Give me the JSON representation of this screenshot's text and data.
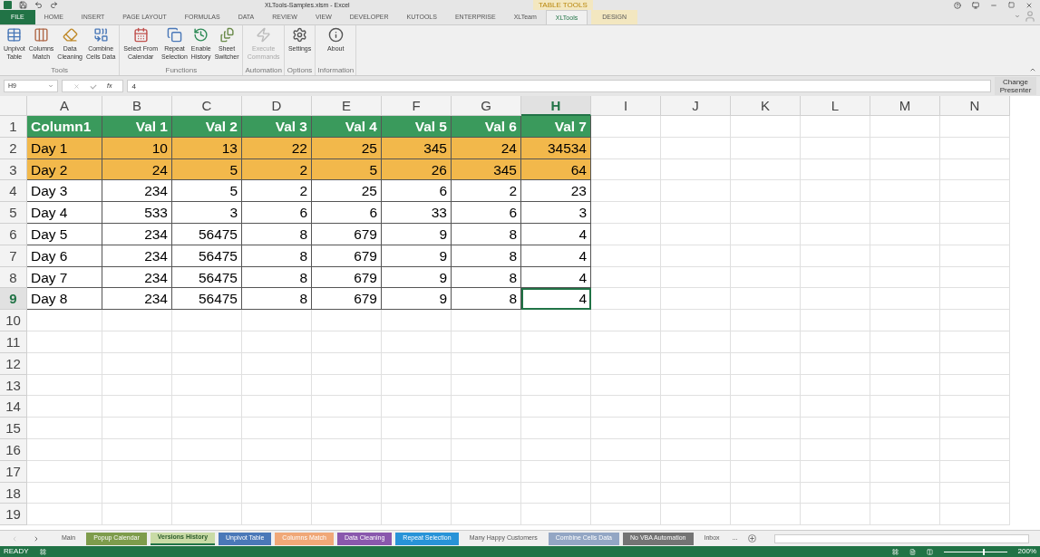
{
  "window": {
    "title": "XLTools-Samples.xlsm - Excel",
    "context_label": "TABLE TOOLS"
  },
  "ribbon_tabs": [
    {
      "label": "FILE",
      "kind": "file",
      "selected": false
    },
    {
      "label": "HOME",
      "kind": "tab",
      "selected": false
    },
    {
      "label": "INSERT",
      "kind": "tab",
      "selected": false
    },
    {
      "label": "PAGE LAYOUT",
      "kind": "tab",
      "selected": false
    },
    {
      "label": "FORMULAS",
      "kind": "tab",
      "selected": false
    },
    {
      "label": "DATA",
      "kind": "tab",
      "selected": false
    },
    {
      "label": "REVIEW",
      "kind": "tab",
      "selected": false
    },
    {
      "label": "VIEW",
      "kind": "tab",
      "selected": false
    },
    {
      "label": "DEVELOPER",
      "kind": "tab",
      "selected": false
    },
    {
      "label": "KUTOOLS",
      "kind": "tab",
      "selected": false
    },
    {
      "label": "ENTERPRISE",
      "kind": "tab",
      "selected": false
    },
    {
      "label": "XLTeam",
      "kind": "tab",
      "selected": false
    },
    {
      "label": "XLTools",
      "kind": "tab",
      "selected": true
    },
    {
      "label": "DESIGN",
      "kind": "context",
      "selected": false
    }
  ],
  "ribbon_groups": [
    {
      "label": "Tools",
      "buttons": [
        {
          "label": "Unpivot\nTable",
          "disabled": false
        },
        {
          "label": "Columns\nMatch",
          "disabled": false
        },
        {
          "label": "Data\nCleaning",
          "disabled": false
        },
        {
          "label": "Combine\nCells Data",
          "disabled": false
        }
      ]
    },
    {
      "label": "Functions",
      "buttons": [
        {
          "label": "Select From\nCalendar",
          "disabled": false
        },
        {
          "label": "Repeat\nSelection",
          "disabled": false
        },
        {
          "label": "Enable\nHistory",
          "disabled": false
        },
        {
          "label": "Sheet\nSwitcher",
          "disabled": false
        }
      ]
    },
    {
      "label": "Automation",
      "buttons": [
        {
          "label": "Execute\nCommands",
          "disabled": true
        }
      ]
    },
    {
      "label": "Options",
      "buttons": [
        {
          "label": "Settings",
          "disabled": false
        }
      ]
    },
    {
      "label": "Information",
      "buttons": [
        {
          "label": "About",
          "disabled": false
        }
      ]
    }
  ],
  "change_presenter": "Change\nPresenter",
  "name_box": "H9",
  "formula_label": "fx",
  "formula": "4",
  "columns": [
    {
      "label": "A",
      "selected": false
    },
    {
      "label": "B",
      "selected": false
    },
    {
      "label": "C",
      "selected": false
    },
    {
      "label": "D",
      "selected": false
    },
    {
      "label": "E",
      "selected": false
    },
    {
      "label": "F",
      "selected": false
    },
    {
      "label": "G",
      "selected": false
    },
    {
      "label": "H",
      "selected": true
    },
    {
      "label": "I",
      "selected": false
    },
    {
      "label": "J",
      "selected": false
    },
    {
      "label": "K",
      "selected": false
    },
    {
      "label": "L",
      "selected": false
    },
    {
      "label": "M",
      "selected": false
    },
    {
      "label": "N",
      "selected": false
    }
  ],
  "rows": [
    {
      "label": "1",
      "selected": false,
      "kind": "header",
      "cells": [
        "Column1",
        "Val 1",
        "Val 2",
        "Val 3",
        "Val 4",
        "Val 5",
        "Val 6",
        "Val 7"
      ]
    },
    {
      "label": "2",
      "selected": false,
      "kind": "highlight",
      "cells": [
        "Day 1",
        "10",
        "13",
        "22",
        "25",
        "345",
        "24",
        "34534"
      ]
    },
    {
      "label": "3",
      "selected": false,
      "kind": "highlight",
      "cells": [
        "Day 2",
        "24",
        "5",
        "2",
        "5",
        "26",
        "345",
        "64"
      ]
    },
    {
      "label": "4",
      "selected": false,
      "kind": "plain",
      "cells": [
        "Day 3",
        "234",
        "5",
        "2",
        "25",
        "6",
        "2",
        "23"
      ]
    },
    {
      "label": "5",
      "selected": false,
      "kind": "plain",
      "cells": [
        "Day 4",
        "533",
        "3",
        "6",
        "6",
        "33",
        "6",
        "3"
      ]
    },
    {
      "label": "6",
      "selected": false,
      "kind": "plain",
      "cells": [
        "Day 5",
        "234",
        "56475",
        "8",
        "679",
        "9",
        "8",
        "4"
      ]
    },
    {
      "label": "7",
      "selected": false,
      "kind": "plain",
      "cells": [
        "Day 6",
        "234",
        "56475",
        "8",
        "679",
        "9",
        "8",
        "4"
      ]
    },
    {
      "label": "8",
      "selected": false,
      "kind": "plain",
      "cells": [
        "Day 7",
        "234",
        "56475",
        "8",
        "679",
        "9",
        "8",
        "4"
      ]
    },
    {
      "label": "9",
      "selected": true,
      "kind": "plain",
      "cells": [
        "Day 8",
        "234",
        "56475",
        "8",
        "679",
        "9",
        "8",
        "4"
      ]
    },
    {
      "label": "10",
      "selected": false
    },
    {
      "label": "11",
      "selected": false
    },
    {
      "label": "12",
      "selected": false
    },
    {
      "label": "13",
      "selected": false
    },
    {
      "label": "14",
      "selected": false
    },
    {
      "label": "15",
      "selected": false
    },
    {
      "label": "16",
      "selected": false
    },
    {
      "label": "17",
      "selected": false
    },
    {
      "label": "18",
      "selected": false
    },
    {
      "label": "19",
      "selected": false
    }
  ],
  "sheet_tabs": [
    {
      "label": "Main",
      "selected": false
    },
    {
      "label": "Popup Calendar",
      "selected": false,
      "color": "#7e9c4c"
    },
    {
      "label": "Versions History",
      "selected": true,
      "color": "#c9dba6"
    },
    {
      "label": "Unpivot Table",
      "selected": false,
      "color": "#4a78b8"
    },
    {
      "label": "Columns Match",
      "selected": false,
      "color": "#f0a878"
    },
    {
      "label": "Data Cleaning",
      "selected": false,
      "color": "#8a58ad"
    },
    {
      "label": "Repeat Selection",
      "selected": false,
      "color": "#2893d8"
    },
    {
      "label": "Many Happy Customers",
      "selected": false
    },
    {
      "label": "Combine Cells Data",
      "selected": false,
      "color": "#93a6c4"
    },
    {
      "label": "No VBA Automation",
      "selected": false,
      "color": "#747474"
    },
    {
      "label": "Inbox",
      "selected": false
    }
  ],
  "more_sheets": "...",
  "status": {
    "text": "READY",
    "zoom": "200%",
    "zoom_slider": {
      "level": 0.62
    }
  }
}
